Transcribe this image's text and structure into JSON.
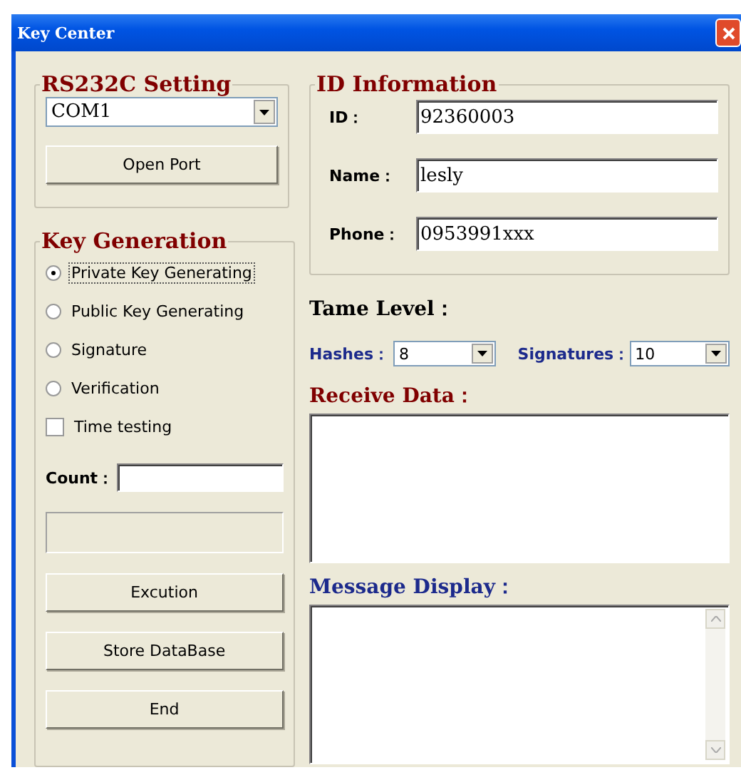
{
  "window": {
    "title": "Key Center"
  },
  "rs232c": {
    "title": "RS232C Setting",
    "port": "COM1",
    "button": "Open Port"
  },
  "key_generation": {
    "title": "Key Generation",
    "options": [
      {
        "kind": "radio",
        "label": "Private Key Generating",
        "selected": true
      },
      {
        "kind": "radio",
        "label": "Public Key Generating",
        "selected": false
      },
      {
        "kind": "radio",
        "label": "Signature",
        "selected": false
      },
      {
        "kind": "radio",
        "label": "Verification",
        "selected": false
      },
      {
        "kind": "checkbox",
        "label": "Time testing",
        "checked": false
      }
    ],
    "count_label": "Count：",
    "buttons": [
      "Excution",
      "Store DataBase",
      "End"
    ]
  },
  "id_information": {
    "title": "ID Information",
    "fields": [
      {
        "label": "ID：",
        "value": "92360003"
      },
      {
        "label": "Name：",
        "value": "lesly"
      },
      {
        "label": "Phone：",
        "value": "0953991xxx"
      }
    ]
  },
  "tame_level": {
    "title": "Tame Level：",
    "hashes": {
      "label": "Hashes：",
      "value": "8"
    },
    "signatures": {
      "label": "Signatures：",
      "value": "10"
    }
  },
  "receive_data": {
    "label": "Receive Data："
  },
  "message_display": {
    "label": "Message Display："
  }
}
